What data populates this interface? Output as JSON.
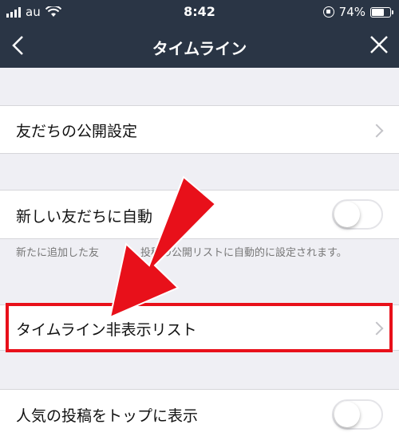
{
  "status_bar": {
    "carrier": "au",
    "time": "8:42",
    "battery_percent": "74%",
    "battery_level": 0.74
  },
  "nav": {
    "title": "タイムライン",
    "back_icon": "chevron-left-icon",
    "close_icon": "close-icon"
  },
  "settings": {
    "friend_privacy": {
      "label": "友だちの公開設定"
    },
    "auto_add_new_friends": {
      "label": "新しい友だちに自動",
      "toggle_on": false,
      "note": "新たに追加した友　　　　投稿の公開リストに自動的に設定されます。"
    },
    "hidden_list": {
      "label": "タイムライン非表示リスト"
    },
    "popular_posts": {
      "label": "人気の投稿をトップに表示",
      "toggle_on": false
    }
  },
  "annotation": {
    "highlight_color": "#e8101a"
  }
}
